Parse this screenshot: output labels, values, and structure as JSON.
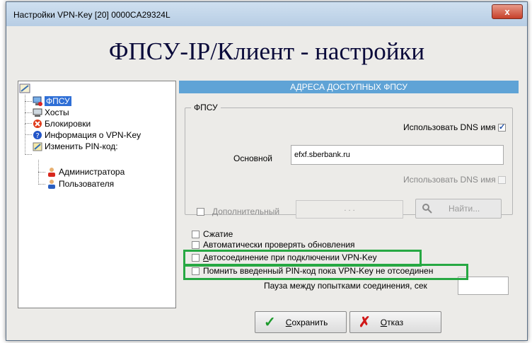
{
  "window": {
    "title": "Настройки VPN-Key [20] 0000CA29324L",
    "close_label": "x",
    "header_title": "ФПСУ-IP/Клиент - настройки"
  },
  "tree": {
    "items": [
      {
        "label": "ФПСУ",
        "icon": "computer-icon"
      },
      {
        "label": "Хосты",
        "icon": "host-icon"
      },
      {
        "label": "Блокировки",
        "icon": "block-icon"
      },
      {
        "label": "Информация о VPN-Key",
        "icon": "info-icon"
      },
      {
        "label": "Изменить PIN-код:",
        "icon": "edit-icon"
      },
      {
        "label": "Администратора",
        "icon": "user-icon"
      },
      {
        "label": "Пользователя",
        "icon": "user-icon"
      }
    ]
  },
  "panel": {
    "section_header": "АДРЕСА ДОСТУПНЫХ ФПСУ",
    "group_title": "ФПСУ",
    "use_dns_label": "Использовать DNS имя",
    "main_label": "Основной",
    "main_value": "efxf.sberbank.ru",
    "use_dns_label_2": "Использовать DNS имя",
    "additional_label": "Дополнительный",
    "additional_value": ". . .",
    "find_label": "Найти...",
    "compression_label": "Сжатие",
    "auto_update_label": "Автоматически проверять обновления",
    "auto_connect_label": "Автосоединение при подключении VPN-Key",
    "remember_pin_label": "Помнить введенный PIN-код пока VPN-Key не отсоединен",
    "pause_label": "Пауза между попытками соединения, сек"
  },
  "footer": {
    "save_label": "Сохранить",
    "cancel_label": "Отказ"
  },
  "colors": {
    "section_header_bg": "#5fa3d6",
    "highlight_green": "#27a843",
    "selection_blue": "#2f6fd6"
  }
}
